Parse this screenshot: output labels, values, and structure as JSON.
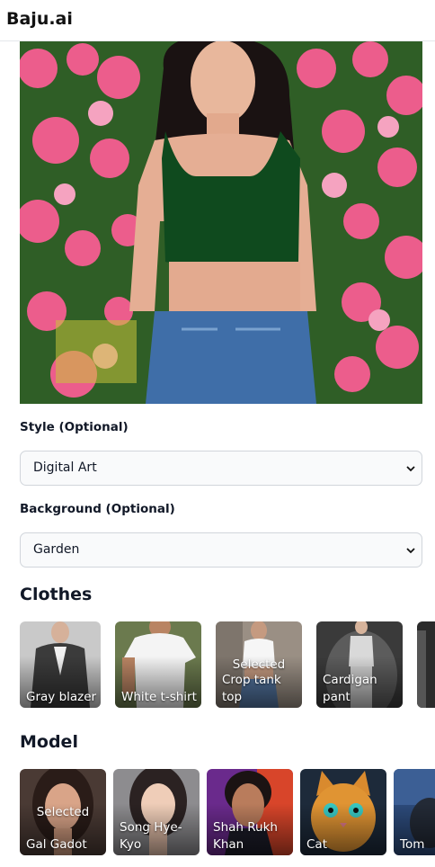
{
  "app": {
    "brand": "Baju.ai"
  },
  "hero": {
    "image": "generated-model-photo"
  },
  "style": {
    "label": "Style (Optional)",
    "value": "Digital Art"
  },
  "background": {
    "label": "Background (Optional)",
    "value": "Garden"
  },
  "clothes": {
    "title": "Clothes",
    "items": [
      {
        "name": "Gray blazer",
        "selected": false
      },
      {
        "name": "White t-shirt",
        "selected": false
      },
      {
        "name": "Crop tank top",
        "selected": true,
        "selected_label": "Selected"
      },
      {
        "name": "Cardigan pant",
        "selected": false
      }
    ]
  },
  "model": {
    "title": "Model",
    "items": [
      {
        "name": "Gal Gadot",
        "selected": true,
        "selected_label": "Selected"
      },
      {
        "name": "Song Hye-Kyo",
        "selected": false
      },
      {
        "name": "Shah Rukh Khan",
        "selected": false
      },
      {
        "name": "Cat",
        "selected": false
      },
      {
        "name": "Tom",
        "selected": false
      }
    ]
  },
  "colors": {
    "accent": "#111827",
    "hero_top": "#0f4a1e",
    "flower": "#e8487a"
  }
}
